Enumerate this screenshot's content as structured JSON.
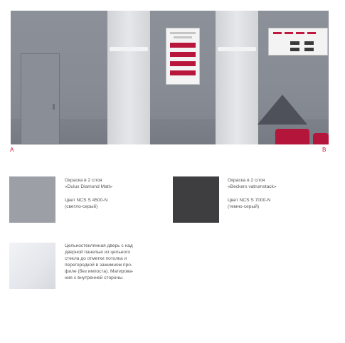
{
  "scene": {
    "left_label": "A",
    "right_label": "B",
    "poster_red_lines": 4,
    "colors": {
      "wall": "#878b93",
      "glass": "#e2e3e6",
      "accent": "#c0183e"
    }
  },
  "materials": [
    {
      "swatch_color": "#9c9fa5",
      "line1": "Окраска в 2 слоя",
      "line2": "«Dulux Diamond Matt»",
      "line3": "Цвет NCS S 4500-N",
      "line4": "(светло-серый)"
    },
    {
      "swatch_color": "#3e3e40",
      "line1": "Окраска в 2 слоя",
      "line2": "«Beckers vatrumstack»",
      "line3": "Цвет NCS S 7000-N",
      "line4": "(темно-серый)"
    },
    {
      "swatch_color": "#e4e6ec",
      "description": "Цельностеклянная дверь с над\nдверной панелью из цельного\nстекла до отметки потолка и\nперегородкой в зажимном про-\nфиле (без импоста). Матирова-\nние с внутренней стороны."
    }
  ]
}
